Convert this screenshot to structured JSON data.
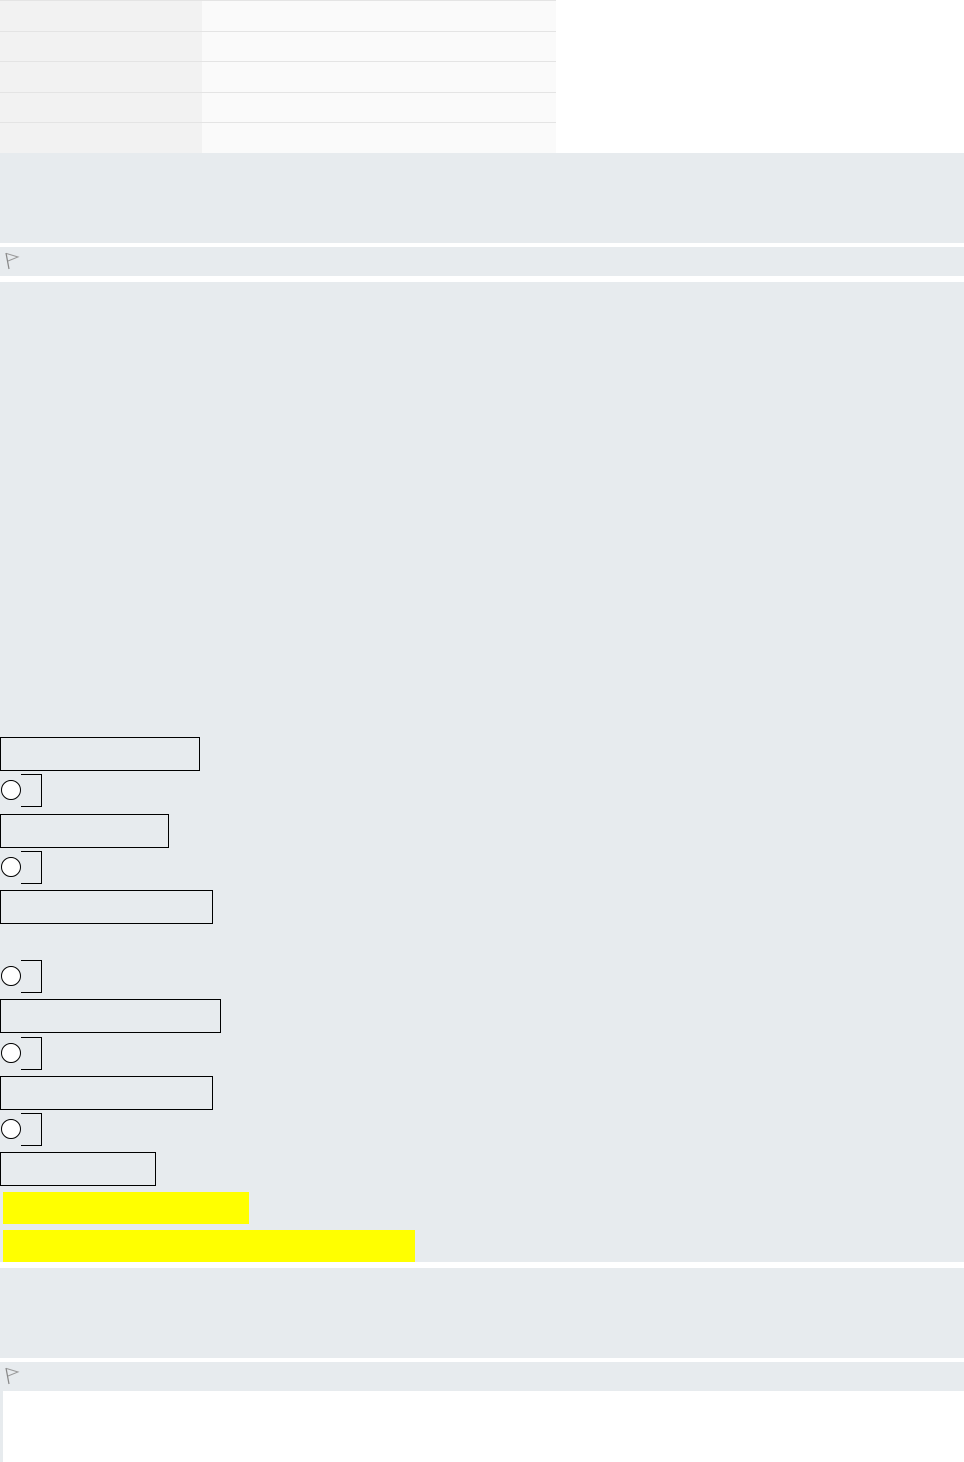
{
  "summary_table": {
    "rows": [
      {
        "label": "",
        "value": ""
      },
      {
        "label": "",
        "value": ""
      },
      {
        "label": "",
        "value": ""
      },
      {
        "label": "",
        "value": ""
      },
      {
        "label": "",
        "value": ""
      }
    ]
  },
  "question": {
    "flag_icon": "flag-icon",
    "answers": [
      {
        "label": ""
      },
      {
        "label": ""
      },
      {
        "label": ""
      },
      {
        "label": ""
      },
      {
        "label": ""
      }
    ],
    "feedback": {
      "specific": "",
      "general": ""
    },
    "colors": {
      "panel_background": "#e7ebee",
      "feedback_highlight": "#ffff00"
    }
  }
}
